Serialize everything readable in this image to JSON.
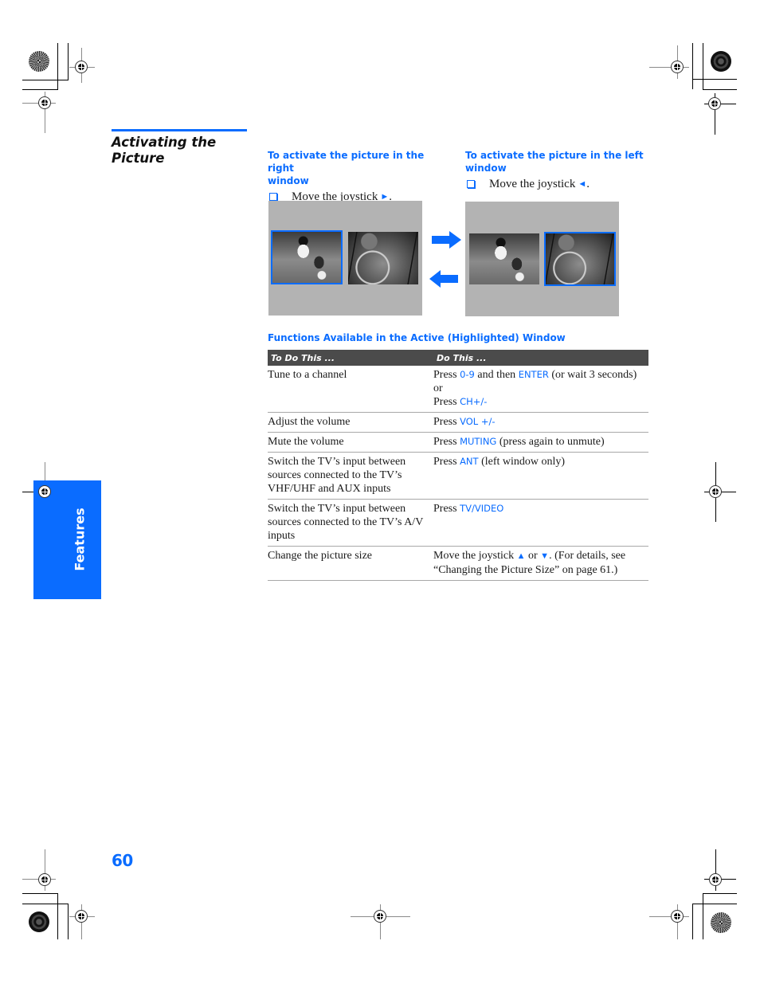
{
  "section": {
    "title_line1": "Activating the",
    "title_line2": "Picture",
    "accent_color": "#0a6cff"
  },
  "instructions": [
    {
      "heading_line1": "To activate the picture in the right",
      "heading_line2": "window",
      "step_text": "Move the joystick",
      "direction_glyph": "➜",
      "direction": "right",
      "step_end": "."
    },
    {
      "heading_line1": "To activate the picture in the left",
      "heading_line2": "window",
      "step_text": "Move the joystick",
      "direction_glyph": "←",
      "direction": "left",
      "step_end": "."
    }
  ],
  "illustration": {
    "screens": [
      {
        "active_window": "left",
        "pictures": [
          "football-player-photo",
          "basketball-hoop-photo"
        ]
      },
      {
        "active_window": "right",
        "pictures": [
          "football-player-photo",
          "basketball-hoop-photo"
        ]
      }
    ],
    "arrows": [
      "arrow-right-icon",
      "arrow-left-icon"
    ]
  },
  "functions_table": {
    "caption": "Functions Available in the Active (Highlighted) Window",
    "headers": [
      "To Do This ...",
      "Do This ..."
    ],
    "rows": [
      {
        "task": "Tune to a channel",
        "action": [
          {
            "t": "Press "
          },
          {
            "k": "0-9"
          },
          {
            "t": " and then "
          },
          {
            "k": "ENTER"
          },
          {
            "t": " (or wait 3 seconds) or"
          },
          {
            "br": true
          },
          {
            "t": "Press "
          },
          {
            "k": "CH+/-"
          }
        ]
      },
      {
        "task": "Adjust the volume",
        "action": [
          {
            "t": "Press "
          },
          {
            "k": "VOL +/-"
          }
        ]
      },
      {
        "task": "Mute the volume",
        "action": [
          {
            "t": "Press "
          },
          {
            "k": "MUTING"
          },
          {
            "t": " (press again to unmute)"
          }
        ]
      },
      {
        "task": "Switch the TV’s input between sources connected to the TV’s VHF/UHF and AUX inputs",
        "action": [
          {
            "t": "Press "
          },
          {
            "k": "ANT"
          },
          {
            "t": " (left window only)"
          }
        ]
      },
      {
        "task": "Switch the TV’s input between sources connected to the TV’s A/V inputs",
        "action": [
          {
            "t": "Press "
          },
          {
            "k": "TV/VIDEO"
          }
        ]
      },
      {
        "task": "Change the picture size",
        "action": [
          {
            "t": "Move the joystick "
          },
          {
            "a": "↑"
          },
          {
            "t": " or "
          },
          {
            "a": "↓"
          },
          {
            "t": ". (For details, see “Changing the Picture Size” on page 61.)"
          }
        ]
      }
    ]
  },
  "side_tab": {
    "label": "Features"
  },
  "page_number": "60"
}
